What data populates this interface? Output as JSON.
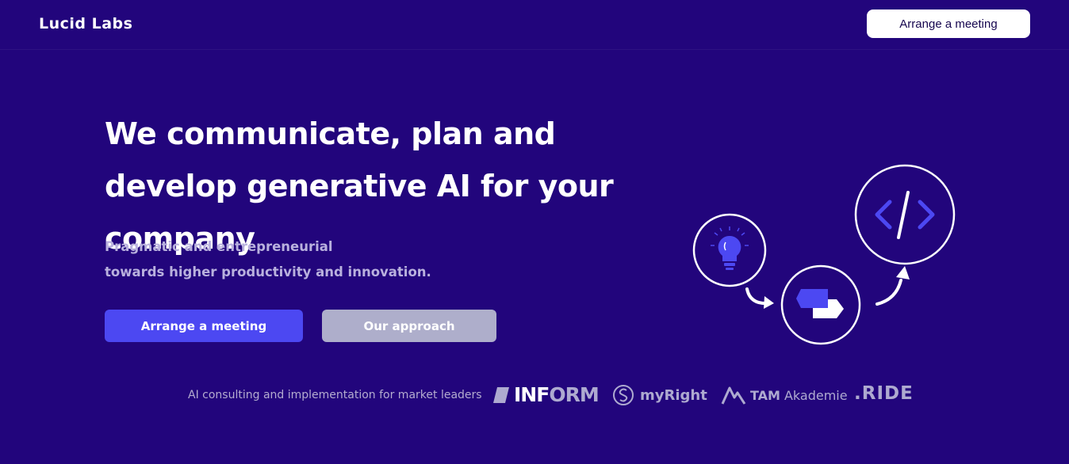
{
  "header": {
    "logo": "Lucid Labs",
    "cta_label": "Arrange a meeting"
  },
  "hero": {
    "headline": "We communicate, plan and develop generative AI for your company",
    "sub_line1": "Pragmatic and entrepreneurial",
    "sub_line2": "towards higher productivity and innovation.",
    "primary_cta": "Arrange a meeting",
    "secondary_cta": "Our approach"
  },
  "illustration": {
    "icons": [
      "lightbulb-icon",
      "chat-bubbles-icon",
      "code-icon",
      "arrow-icon"
    ],
    "accent": "#4c48f2"
  },
  "trust": {
    "text": "AI consulting and implementation for market leaders",
    "logos": {
      "inform_a": "INF",
      "inform_b": "ORM",
      "myright": "myRight",
      "tam_bold": "TAM",
      "tam_rest": "Akademie",
      "ride": ".RIDE"
    }
  },
  "colors": {
    "background": "#22057c",
    "accent": "#4c48f2",
    "secondary_button": "#aeaecb",
    "muted_text": "#b9b1de"
  }
}
